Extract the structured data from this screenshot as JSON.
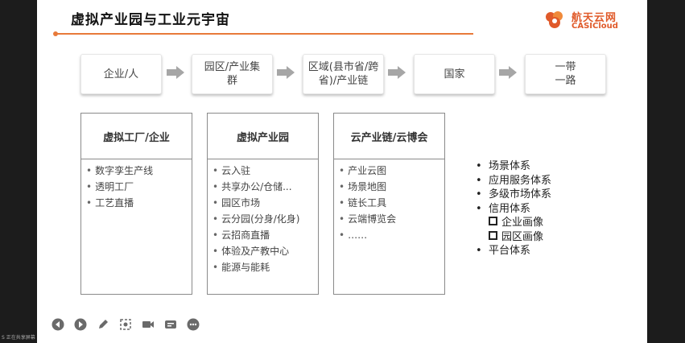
{
  "slide": {
    "title": "虚拟产业园与工业元宇宙",
    "logo": {
      "cn": "航天云网",
      "en": "CASICloud"
    }
  },
  "flow": [
    {
      "label": "企业/人"
    },
    {
      "label": "园区/产业集群"
    },
    {
      "label": "区域(县市省/跨省)/产业链"
    },
    {
      "label": "国家"
    },
    {
      "label": "一带一路"
    }
  ],
  "columns": [
    {
      "title": "虚拟工厂/企业",
      "items": [
        "数字孪生产线",
        "透明工厂",
        "工艺直播"
      ]
    },
    {
      "title": "虚拟产业园",
      "items": [
        "云入驻",
        "共享办公/仓储...",
        "园区市场",
        "云分园(分身/化身)",
        "云招商直播",
        "体验及产教中心",
        "能源与能耗"
      ]
    },
    {
      "title": "云产业链/云博会",
      "items": [
        "产业云图",
        "场景地图",
        "链长工具",
        "云端博览会",
        "……"
      ]
    }
  ],
  "systems": [
    {
      "label": "场景体系",
      "level": 1
    },
    {
      "label": "应用服务体系",
      "level": 1
    },
    {
      "label": "多级市场体系",
      "level": 1
    },
    {
      "label": "信用体系",
      "level": 1
    },
    {
      "label": "企业画像",
      "level": 2
    },
    {
      "label": "园区画像",
      "level": 2
    },
    {
      "label": "平台体系",
      "level": 1
    }
  ],
  "toolbar": [
    {
      "icon": "previous-icon"
    },
    {
      "icon": "next-icon"
    },
    {
      "icon": "pen-icon"
    },
    {
      "icon": "zoom-icon"
    },
    {
      "icon": "camera-icon"
    },
    {
      "icon": "subtitle-icon"
    },
    {
      "icon": "more-icon"
    }
  ],
  "status_text": "S 正在共享屏幕",
  "colors": {
    "accent": "#e87a3a",
    "logo": "#e05a2a",
    "arrow": "#a6a6a6"
  }
}
